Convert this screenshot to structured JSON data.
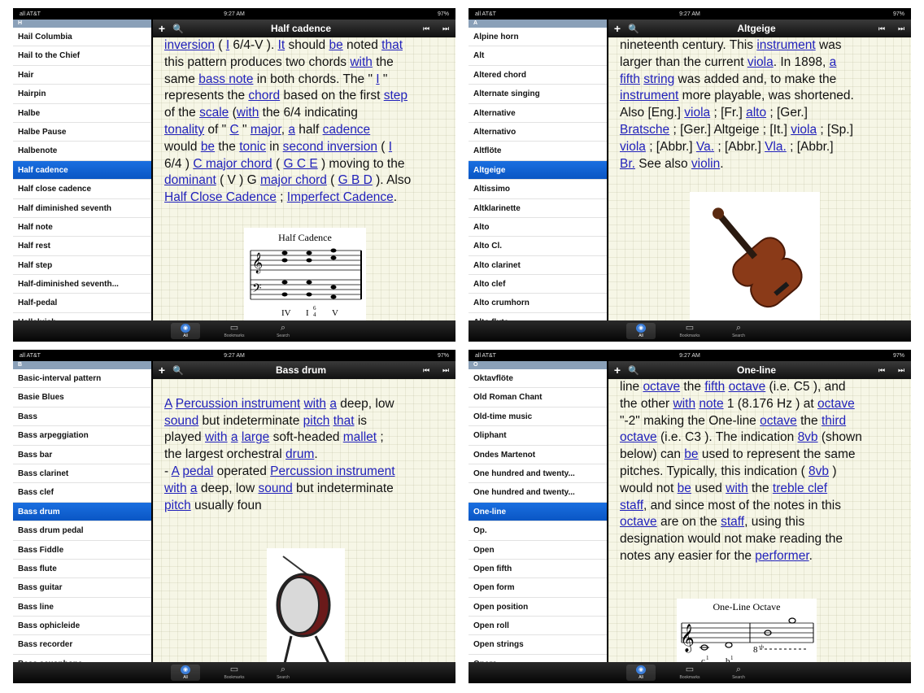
{
  "panes": [
    {
      "status": {
        "carrier": "all AT&T",
        "time": "9:27 AM",
        "battery": "97%"
      },
      "nav": {
        "title": "Half cadence",
        "add": "+",
        "search": "🔍",
        "prev": "⏮",
        "next": "⏭"
      },
      "section": "H",
      "items": [
        "Hail Columbia",
        "Hail to the Chief",
        "Hair",
        "Hairpin",
        "Halbe",
        "Halbe Pause",
        "Halbenote",
        "Half cadence",
        "Half close cadence",
        "Half diminished seventh",
        "Half note",
        "Half rest",
        "Half step",
        "Half-diminished seventh...",
        "Half-pedal",
        "Halleluiah"
      ],
      "selected": 7,
      "index": [
        "A",
        "B",
        "C",
        "D",
        "E",
        "F",
        "G",
        "H",
        "I",
        "J",
        "K",
        "L",
        "M",
        "N",
        "O",
        "P",
        "Q",
        "R",
        "S",
        "T",
        "U",
        "V",
        "W",
        "X",
        "Y",
        "Z",
        "#"
      ],
      "text": [
        [
          "inversion",
          1
        ],
        [
          " ( ",
          0
        ],
        [
          "I",
          1
        ],
        [
          " 6/4-V ). ",
          0
        ],
        [
          "It",
          1
        ],
        [
          " should ",
          0
        ],
        [
          "be",
          1
        ],
        [
          " noted ",
          0
        ],
        [
          "that",
          1
        ],
        [
          "\nthis pattern produces two chords ",
          0
        ],
        [
          "with",
          1
        ],
        [
          " the\nsame ",
          0
        ],
        [
          "bass note",
          1
        ],
        [
          " in both chords. The \" ",
          0
        ],
        [
          "I",
          1
        ],
        [
          " \"\nrepresents the ",
          0
        ],
        [
          "chord",
          1
        ],
        [
          " based on the first ",
          0
        ],
        [
          "step",
          1
        ],
        [
          "\nof the ",
          0
        ],
        [
          "scale",
          1
        ],
        [
          " (",
          0
        ],
        [
          "with",
          1
        ],
        [
          " the 6/4 indicating\n",
          0
        ],
        [
          "tonality",
          1
        ],
        [
          " of \" ",
          0
        ],
        [
          "C",
          1
        ],
        [
          " \" ",
          0
        ],
        [
          "major",
          1
        ],
        [
          ", ",
          0
        ],
        [
          "a",
          1
        ],
        [
          " half ",
          0
        ],
        [
          "cadence",
          1
        ],
        [
          "\nwould ",
          0
        ],
        [
          "be",
          1
        ],
        [
          " the ",
          0
        ],
        [
          "tonic",
          1
        ],
        [
          " in ",
          0
        ],
        [
          "second inversion",
          1
        ],
        [
          " ( ",
          0
        ],
        [
          "I",
          1
        ],
        [
          "\n6/4 ) ",
          0
        ],
        [
          "C major chord",
          1
        ],
        [
          " ( ",
          0
        ],
        [
          "G C E",
          1
        ],
        [
          " ) moving to the\n",
          0
        ],
        [
          "dominant",
          1
        ],
        [
          " ( V ) G ",
          0
        ],
        [
          "major chord",
          1
        ],
        [
          " ( ",
          0
        ],
        [
          "G B D",
          1
        ],
        [
          " ). Also\n",
          0
        ],
        [
          "Half Close Cadence",
          1
        ],
        [
          " ; ",
          0
        ],
        [
          "Imperfect Cadence",
          1
        ],
        [
          ".",
          0
        ]
      ],
      "figure": {
        "type": "half-cadence",
        "title": "Half Cadence",
        "labels": [
          "IV",
          "I",
          "6",
          "4",
          "V"
        ]
      }
    },
    {
      "status": {
        "carrier": "all AT&T",
        "time": "9:27 AM",
        "battery": "97%"
      },
      "nav": {
        "title": "Altgeige",
        "add": "+",
        "search": "🔍",
        "prev": "⏮",
        "next": "⏭"
      },
      "section": "A",
      "items": [
        "Alpine horn",
        "Alt",
        "Altered chord",
        "Alternate singing",
        "Alternative",
        "Alternativo",
        "Altflöte",
        "Altgeige",
        "Altissimo",
        "Altklarinette",
        "Alto",
        "Alto Cl.",
        "Alto clarinet",
        "Alto clef",
        "Alto crumhorn",
        "Alto flute"
      ],
      "selected": 7,
      "index": [
        "A",
        "B",
        "C",
        "D",
        "E",
        "F",
        "G",
        "H",
        "I",
        "J",
        "K",
        "L",
        "M",
        "N",
        "O",
        "P",
        "Q",
        "R",
        "S",
        "T",
        "U",
        "V",
        "W",
        "X",
        "Y",
        "Z",
        "#"
      ],
      "text": [
        [
          "nineteenth century. This ",
          0
        ],
        [
          "instrument",
          1
        ],
        [
          " was\nlarger than the current ",
          0
        ],
        [
          "viola",
          1
        ],
        [
          ". In 1898, ",
          0
        ],
        [
          "a",
          1
        ],
        [
          "\n",
          0
        ],
        [
          "fifth",
          1
        ],
        [
          " ",
          0
        ],
        [
          "string",
          1
        ],
        [
          " was added and, to make the\n",
          0
        ],
        [
          "instrument",
          1
        ],
        [
          " more playable, was shortened.\nAlso [Eng.] ",
          0
        ],
        [
          "viola",
          1
        ],
        [
          " ; [Fr.] ",
          0
        ],
        [
          "alto",
          1
        ],
        [
          " ; [Ger.]\n",
          0
        ],
        [
          "Bratsche",
          1
        ],
        [
          " ; [Ger.] Altgeige ; [It.] ",
          0
        ],
        [
          "viola",
          1
        ],
        [
          " ; [Sp.]\n",
          0
        ],
        [
          "viola",
          1
        ],
        [
          " ; [Abbr.] ",
          0
        ],
        [
          "Va.",
          1
        ],
        [
          " ; [Abbr.] ",
          0
        ],
        [
          "Vla.",
          1
        ],
        [
          " ; [Abbr.]\n",
          0
        ],
        [
          "Br.",
          1
        ],
        [
          " See also ",
          0
        ],
        [
          "violin",
          1
        ],
        [
          ".",
          0
        ]
      ],
      "figure": {
        "type": "violin"
      }
    },
    {
      "status": {
        "carrier": "all AT&T",
        "time": "9:27 AM",
        "battery": "97%"
      },
      "nav": {
        "title": "Bass drum",
        "add": "+",
        "search": "🔍",
        "prev": "⏮",
        "next": "⏭"
      },
      "section": "B",
      "items": [
        "Basic-interval pattern",
        "Basie Blues",
        "Bass",
        "Bass arpeggiation",
        "Bass bar",
        "Bass clarinet",
        "Bass clef",
        "Bass drum",
        "Bass drum pedal",
        "Bass Fiddle",
        "Bass flute",
        "Bass guitar",
        "Bass line",
        "Bass ophicleide",
        "Bass recorder",
        "Bass saxophone"
      ],
      "selected": 7,
      "index": [
        "A",
        "B",
        "C",
        "D",
        "E",
        "F",
        "G",
        "H",
        "I",
        "J",
        "K",
        "L",
        "M",
        "N",
        "O",
        "P",
        "Q",
        "R",
        "S",
        "T",
        "U",
        "V",
        "W",
        "X",
        "Y",
        "Z",
        "#"
      ],
      "text": [
        [
          "\n",
          0
        ],
        [
          "A",
          1
        ],
        [
          " ",
          0
        ],
        [
          "Percussion instrument",
          1
        ],
        [
          " ",
          0
        ],
        [
          "with",
          1
        ],
        [
          " ",
          0
        ],
        [
          "a",
          1
        ],
        [
          " deep, low\n",
          0
        ],
        [
          "sound",
          1
        ],
        [
          " but indeterminate ",
          0
        ],
        [
          "pitch",
          1
        ],
        [
          " ",
          0
        ],
        [
          "that",
          1
        ],
        [
          " is\nplayed ",
          0
        ],
        [
          "with",
          1
        ],
        [
          " ",
          0
        ],
        [
          "a",
          1
        ],
        [
          " ",
          0
        ],
        [
          "large",
          1
        ],
        [
          " soft-headed ",
          0
        ],
        [
          "mallet",
          1
        ],
        [
          " ;\nthe largest orchestral ",
          0
        ],
        [
          "drum",
          1
        ],
        [
          ".\n- ",
          0
        ],
        [
          "A",
          1
        ],
        [
          " ",
          0
        ],
        [
          "pedal",
          1
        ],
        [
          " operated ",
          0
        ],
        [
          "Percussion instrument",
          1
        ],
        [
          "\n",
          0
        ],
        [
          "with",
          1
        ],
        [
          " ",
          0
        ],
        [
          "a",
          1
        ],
        [
          " deep, low ",
          0
        ],
        [
          "sound",
          1
        ],
        [
          " but indeterminate\n",
          0
        ],
        [
          "pitch",
          1
        ],
        [
          " usually foun",
          0
        ]
      ],
      "figure": {
        "type": "drum"
      }
    },
    {
      "status": {
        "carrier": "all AT&T",
        "time": "9:27 AM",
        "battery": "97%"
      },
      "nav": {
        "title": "One-line",
        "add": "+",
        "search": "🔍",
        "prev": "⏮",
        "next": "⏭"
      },
      "section": "O",
      "items": [
        "Oktavflöte",
        "Old Roman Chant",
        "Old-time music",
        "Oliphant",
        "Ondes Martenot",
        "One hundred and twenty...",
        "One hundred and twenty...",
        "One-line",
        "Op.",
        "Open",
        "Open fifth",
        "Open form",
        "Open position",
        "Open roll",
        "Open strings",
        "Opera"
      ],
      "selected": 7,
      "index": [
        "A",
        "B",
        "C",
        "D",
        "E",
        "F",
        "G",
        "H",
        "I",
        "J",
        "K",
        "L",
        "M",
        "N",
        "O",
        "P",
        "Q",
        "R",
        "S",
        "T",
        "U",
        "V",
        "W",
        "X",
        "Y",
        "Z",
        "#"
      ],
      "text": [
        [
          "line ",
          0
        ],
        [
          "octave",
          1
        ],
        [
          " the ",
          0
        ],
        [
          "fifth",
          1
        ],
        [
          " ",
          0
        ],
        [
          "octave",
          1
        ],
        [
          " (i.e. C5 ), and\nthe other ",
          0
        ],
        [
          "with",
          1
        ],
        [
          " ",
          0
        ],
        [
          "note",
          1
        ],
        [
          " 1 (8.176 Hz ) at ",
          0
        ],
        [
          "octave",
          1
        ],
        [
          "\n\"-2\" making the One-line ",
          0
        ],
        [
          "octave",
          1
        ],
        [
          " the ",
          0
        ],
        [
          "third",
          1
        ],
        [
          "\n",
          0
        ],
        [
          "octave",
          1
        ],
        [
          " (i.e. C3 ). The indication ",
          0
        ],
        [
          "8vb",
          1
        ],
        [
          " (shown\nbelow) can ",
          0
        ],
        [
          "be",
          1
        ],
        [
          " used to represent the same\npitches. Typically, this indication ( ",
          0
        ],
        [
          "8vb",
          1
        ],
        [
          " )\nwould not ",
          0
        ],
        [
          "be",
          1
        ],
        [
          " used ",
          0
        ],
        [
          "with",
          1
        ],
        [
          " the ",
          0
        ],
        [
          "treble clef",
          1
        ],
        [
          "\n",
          0
        ],
        [
          "staff",
          1
        ],
        [
          ", and since most of the notes in this\n",
          0
        ],
        [
          "octave",
          1
        ],
        [
          " are on the ",
          0
        ],
        [
          "staff",
          1
        ],
        [
          ", using this\ndesignation would not make reading the\nnotes any easier for the ",
          0
        ],
        [
          "performer",
          1
        ],
        [
          ".",
          0
        ]
      ],
      "figure": {
        "type": "one-line",
        "title": "One-Line Octave",
        "labels": [
          "c",
          "1",
          "b",
          "1",
          "8",
          "vb"
        ]
      }
    }
  ],
  "tabs": [
    {
      "label": "All",
      "icon": "globe-icon"
    },
    {
      "label": "Bookmarks",
      "icon": "book-icon"
    },
    {
      "label": "Search",
      "icon": "search-icon"
    }
  ],
  "colors": {
    "accent": "#1a6fe0",
    "link": "#2222bb",
    "paper": "#f6f6e6"
  }
}
